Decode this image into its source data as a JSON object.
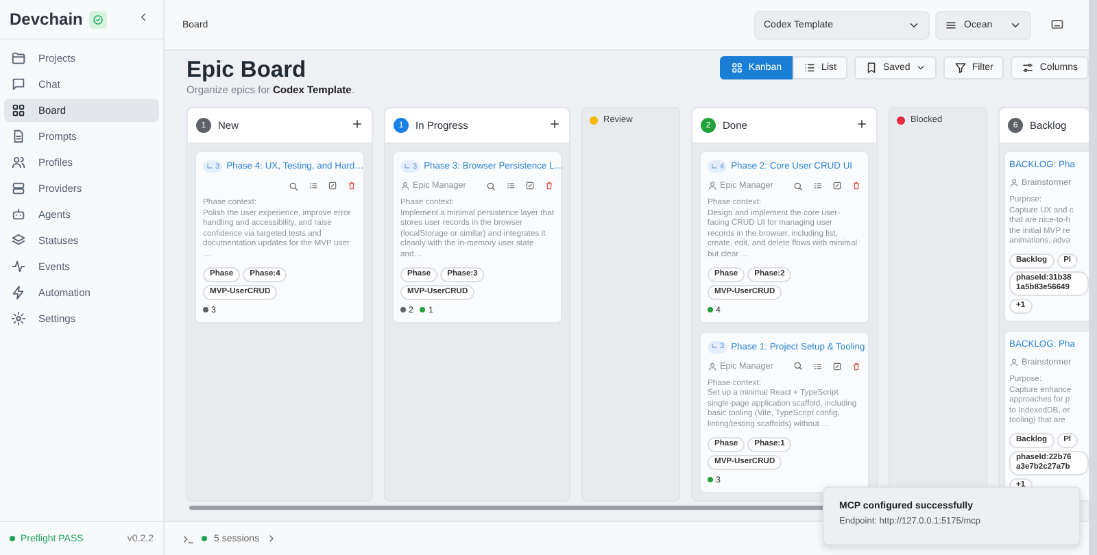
{
  "sidebar": {
    "brand": "Devchain",
    "items": [
      {
        "label": "Projects",
        "selected": false
      },
      {
        "label": "Chat",
        "selected": false
      },
      {
        "label": "Board",
        "selected": true
      },
      {
        "label": "Prompts",
        "selected": false
      },
      {
        "label": "Profiles",
        "selected": false
      },
      {
        "label": "Providers",
        "selected": false
      },
      {
        "label": "Agents",
        "selected": false
      },
      {
        "label": "Statuses",
        "selected": false
      },
      {
        "label": "Events",
        "selected": false
      },
      {
        "label": "Automation",
        "selected": false
      },
      {
        "label": "Settings",
        "selected": false
      }
    ],
    "preflight": "Preflight PASS",
    "version": "v0.2.2"
  },
  "header": {
    "breadcrumb": "Board",
    "project_select": "Codex Template",
    "theme_select": "Ocean"
  },
  "page": {
    "title": "Epic Board",
    "subtitle_prefix": "Organize epics for ",
    "subtitle_project": "Codex Template",
    "subtitle_suffix": ".",
    "views": [
      {
        "label": "Kanban",
        "selected": true
      },
      {
        "label": "List",
        "selected": false
      }
    ],
    "actions": [
      "Saved",
      "Filter",
      "Columns"
    ]
  },
  "columns": [
    {
      "title": "New",
      "count": "1",
      "color": "#5f6368",
      "collapsed": false,
      "cards": [
        {
          "subtasks": "3",
          "title": "Phase 4: UX, Testing, and Hard…",
          "context_label": "Phase context:",
          "description": "Polish the user experience, improve error handling and accessibility, and raise confidence via targeted tests and documentation updates for the MVP user …",
          "tags": [
            "Phase",
            "Phase:4",
            "MVP-UserCRUD"
          ],
          "stats": [
            {
              "value": "3",
              "color": "#5f6368"
            }
          ]
        }
      ]
    },
    {
      "title": "In Progress",
      "count": "1",
      "color": "#1a7fe8",
      "collapsed": false,
      "cards": [
        {
          "subtasks": "3",
          "title": "Phase 3: Browser Persistence L…",
          "agent": "Epic Manager",
          "context_label": "Phase context:",
          "description": "Implement a minimal persistence layer that stores user records in the browser (localStorage or similar) and integrates it cleanly with the in-memory user state and…",
          "tags": [
            "Phase",
            "Phase:3",
            "MVP-UserCRUD"
          ],
          "stats": [
            {
              "value": "2",
              "color": "#5f6368"
            },
            {
              "value": "1",
              "color": "#22a33a"
            }
          ]
        }
      ]
    },
    {
      "title": "Review",
      "color": "#f5b800",
      "collapsed": true
    },
    {
      "title": "Done",
      "count": "2",
      "color": "#22a33a",
      "collapsed": false,
      "cards": [
        {
          "subtasks": "4",
          "title": "Phase 2: Core User CRUD UI",
          "agent": "Epic Manager",
          "context_label": "Phase context:",
          "description": "Design and implement the core user-facing CRUD UI for managing user records in the browser, including list, create, edit, and delete flows with minimal but clear …",
          "tags": [
            "Phase",
            "Phase:2",
            "MVP-UserCRUD"
          ],
          "stats": [
            {
              "value": "4",
              "color": "#22a33a"
            }
          ]
        },
        {
          "subtasks": "3",
          "title": "Phase 1: Project Setup & Tooling",
          "agent": "Epic Manager",
          "context_label": "Phase context:",
          "description": "Set up a minimal React + TypeScript single-page application scaffold, including basic tooling (Vite, TypeScript config, linting/testing scaffolds) without …",
          "tags": [
            "Phase",
            "Phase:1",
            "MVP-UserCRUD"
          ],
          "stats": [
            {
              "value": "3",
              "color": "#22a33a"
            }
          ]
        }
      ]
    },
    {
      "title": "Blocked",
      "color": "#e8283c",
      "collapsed": true
    },
    {
      "title": "Backlog",
      "count": "6",
      "color": "#5f6368",
      "collapsed": false,
      "cards": [
        {
          "title": "BACKLOG: Pha",
          "agent": "Brainstormer",
          "context_label": "Purpose:",
          "description_lines": [
            "Capture UX and c",
            "that are nice-to-h",
            "the initial MVP re",
            "animations, adva"
          ],
          "tags": [
            "Backlog",
            "Pl",
            "phaseId:31b38 1a5b83e56649",
            "+1"
          ]
        },
        {
          "title": "BACKLOG: Pha",
          "agent": "Brainstormer",
          "context_label": "Purpose:",
          "description_lines": [
            "Capture enhance",
            "approaches for p",
            "to IndexedDB, er",
            "tooling) that are"
          ],
          "tags": [
            "Backlog",
            "Pl",
            "phaseId:22b76 a3e7b2c27a7b",
            "+1"
          ]
        }
      ]
    }
  ],
  "sessions": "5 sessions",
  "toast": {
    "title": "MCP configured successfully",
    "message": "Endpoint: http://127.0.0.1:5175/mcp"
  }
}
